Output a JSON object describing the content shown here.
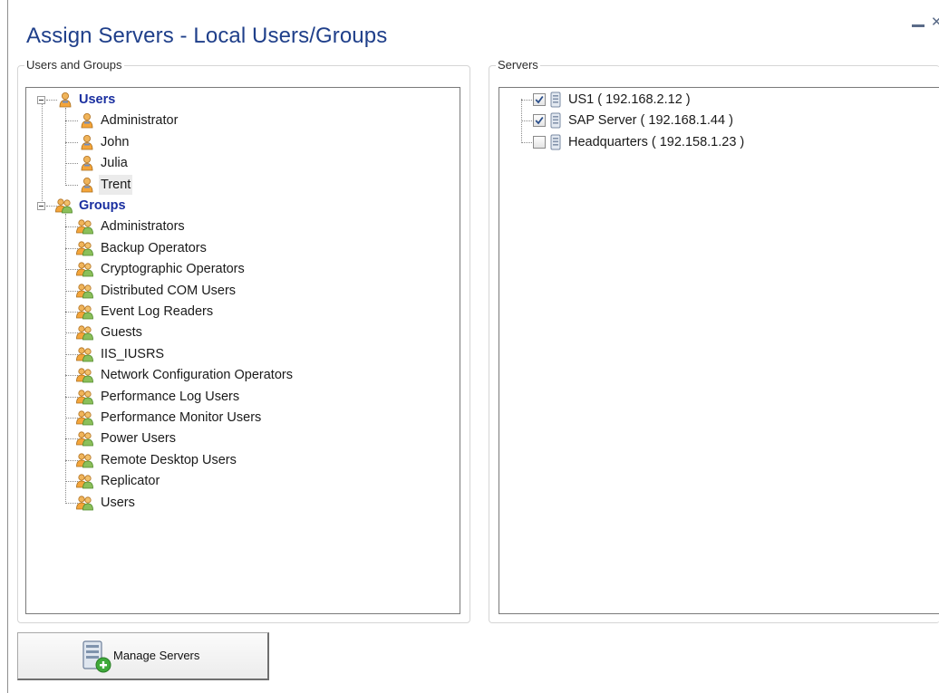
{
  "window": {
    "title": "Assign Servers - Local Users/Groups",
    "minimize_icon": "minimize-icon",
    "close_icon": "close-icon",
    "close_glyph": "✕"
  },
  "users_groups": {
    "legend": "Users and Groups",
    "users_node": {
      "label": "Users",
      "expanded": true,
      "icon": "user-icon"
    },
    "users": [
      "Administrator",
      "John",
      "Julia",
      "Trent"
    ],
    "selected_user": "Trent",
    "groups_node": {
      "label": "Groups",
      "expanded": true,
      "icon": "group-icon"
    },
    "groups": [
      "Administrators",
      "Backup Operators",
      "Cryptographic Operators",
      "Distributed COM Users",
      "Event Log Readers",
      "Guests",
      "IIS_IUSRS",
      "Network Configuration Operators",
      "Performance Log Users",
      "Performance Monitor Users",
      "Power Users",
      "Remote Desktop Users",
      "Replicator",
      "Users"
    ]
  },
  "servers": {
    "legend": "Servers",
    "items": [
      {
        "label": "US1 ( 192.168.2.12 )",
        "checked": true,
        "icon": "server-icon"
      },
      {
        "label": "SAP Server ( 192.168.1.44 )",
        "checked": true,
        "icon": "server-icon"
      },
      {
        "label": "Headquarters ( 192.158.1.23 )",
        "checked": false,
        "icon": "server-icon"
      }
    ]
  },
  "manage_button": {
    "label": "Manage Servers",
    "icon": "manage-servers-icon"
  },
  "colors": {
    "title": "#1f3f8a",
    "tree_bold": "#1a2fa0",
    "selection": "#ebebeb"
  }
}
